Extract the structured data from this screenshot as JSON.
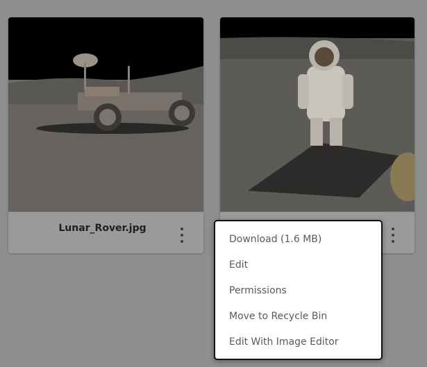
{
  "cards": [
    {
      "name": "Lunar_Rover.jpg",
      "image": "lunar-rover-photo"
    },
    {
      "name": "",
      "image": "astronaut-photo"
    }
  ],
  "context_menu": {
    "items": [
      "Download (1.6 MB)",
      "Edit",
      "Permissions",
      "Move to Recycle Bin",
      "Edit With Image Editor"
    ]
  },
  "icons": {
    "more": "more-vertical-icon"
  }
}
